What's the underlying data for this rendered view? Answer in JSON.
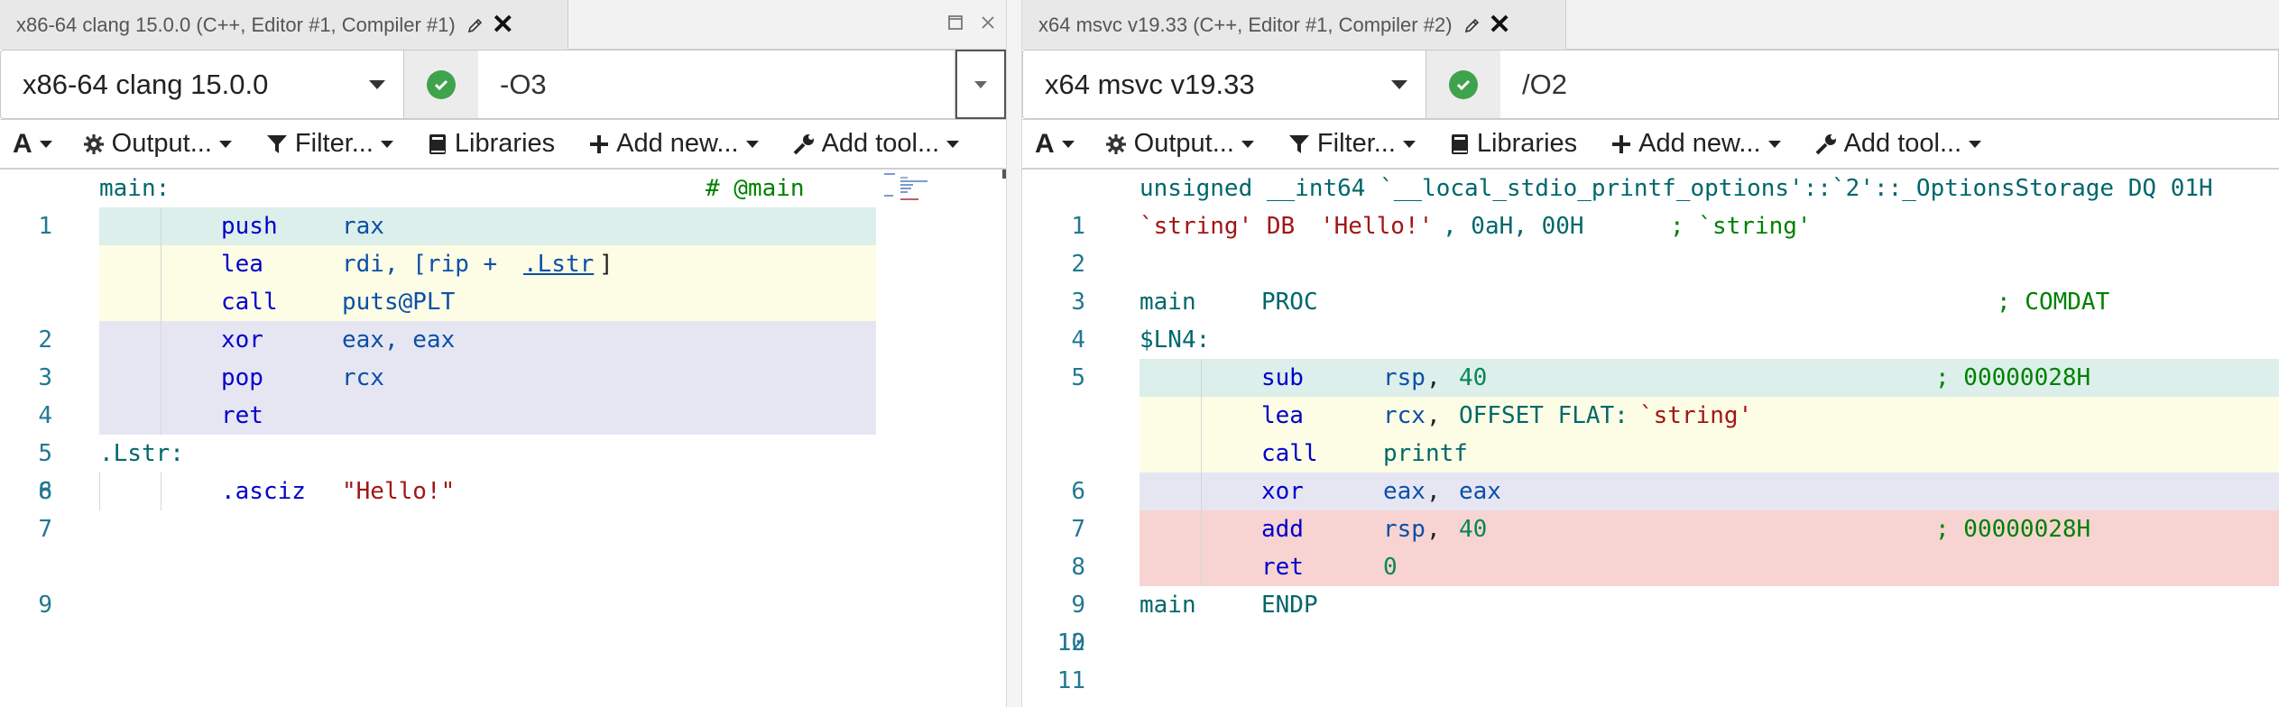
{
  "left_pane": {
    "tab_title": "x86-64 clang 15.0.0 (C++, Editor #1, Compiler #1)",
    "compiler_name": "x86-64 clang 15.0.0",
    "flags": "-O3",
    "toolbar": {
      "output": "Output...",
      "filter": "Filter...",
      "libraries": "Libraries",
      "add_new": "Add new...",
      "add_tool": "Add tool..."
    },
    "code_lines": [
      {
        "num": "1",
        "label": "main:",
        "instr": "",
        "ops": "",
        "comment": "# @main"
      },
      {
        "num": "2",
        "label": "",
        "instr": "push",
        "ops": "rax",
        "comment": ""
      },
      {
        "num": "3",
        "label": "",
        "instr": "lea",
        "ops": "rdi, [rip + ",
        "link": ".Lstr",
        "ops_after": "]",
        "comment": ""
      },
      {
        "num": "4",
        "label": "",
        "instr": "call",
        "ops": "puts@PLT",
        "comment": ""
      },
      {
        "num": "5",
        "label": "",
        "instr": "xor",
        "ops": "eax, eax",
        "comment": ""
      },
      {
        "num": "6",
        "label": "",
        "instr": "pop",
        "ops": "rcx",
        "comment": ""
      },
      {
        "num": "7",
        "label": "",
        "instr": "ret",
        "ops": "",
        "comment": ""
      },
      {
        "num": "8",
        "label": ".Lstr:",
        "instr": "",
        "ops": "",
        "comment": ""
      },
      {
        "num": "9",
        "label": "",
        "instr": ".asciz",
        "ops": "",
        "string": "\"Hello!\"",
        "comment": ""
      }
    ]
  },
  "right_pane": {
    "tab_title": "x64 msvc v19.33 (C++, Editor #1, Compiler #2)",
    "compiler_name": "x64 msvc v19.33",
    "flags": "/O2",
    "toolbar": {
      "output": "Output...",
      "filter": "Filter...",
      "libraries": "Libraries",
      "add_new": "Add new...",
      "add_tool": "Add tool..."
    },
    "code_lines": [
      {
        "num": "1",
        "text": "unsigned __int64 `__local_stdio_printf_options'::`2'::_OptionsStorage DQ 01H"
      },
      {
        "num": "2",
        "prefix": "`string' DB ",
        "str": "'Hello!'",
        "mid": ", 0aH, 00H",
        "comment": "; `string'"
      },
      {
        "num": "3"
      },
      {
        "num": "4",
        "label": "main",
        "instr": "PROC",
        "comment": "; COMDAT"
      },
      {
        "num": "5",
        "label": "$LN4:"
      },
      {
        "num": "6",
        "instr": "sub",
        "reg": "rsp",
        "num_op": "40",
        "comment": "; 00000028H"
      },
      {
        "num": "7",
        "instr": "lea",
        "reg": "rcx",
        "rest": "OFFSET FLAT:",
        "str": "`string'"
      },
      {
        "num": "8",
        "instr": "call",
        "rest_plain": "printf"
      },
      {
        "num": "9",
        "instr": "xor",
        "reg": "eax",
        "reg2": "eax"
      },
      {
        "num": "10",
        "instr": "add",
        "reg": "rsp",
        "num_op": "40",
        "comment": "; 00000028H"
      },
      {
        "num": "11",
        "instr": "ret",
        "num_op": "0"
      },
      {
        "num": "12",
        "label": "main",
        "instr": "ENDP"
      }
    ]
  },
  "colors": {
    "highlight_teal": "#dcefea",
    "highlight_yellow": "#fdfde5",
    "highlight_lavender": "#e6e6f2",
    "highlight_red": "#f7d4d2",
    "status_ok": "#3fa34d"
  }
}
